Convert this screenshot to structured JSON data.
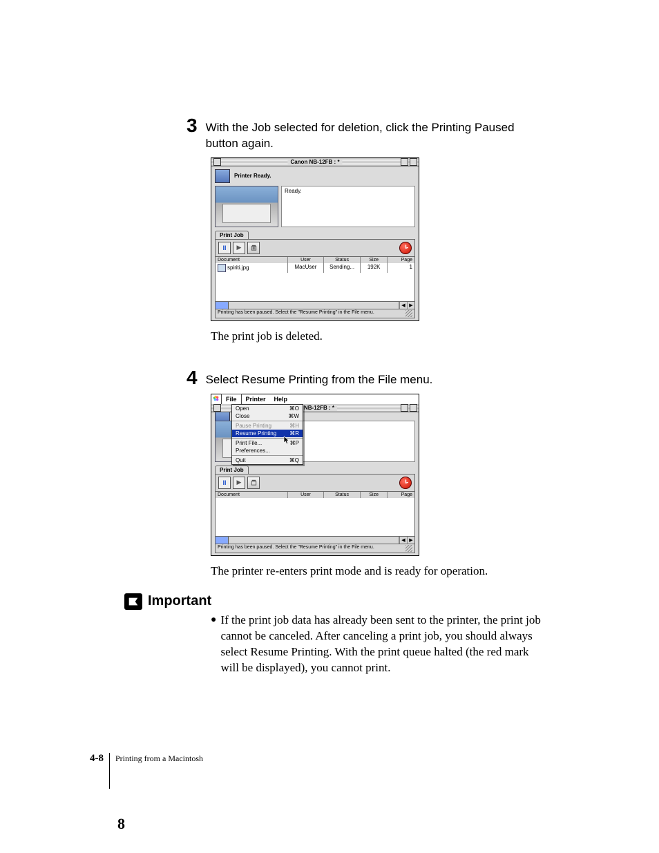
{
  "step3": {
    "num": "3",
    "text": "With the Job selected for deletion, click the Printing Paused button again.",
    "after": "The print job is deleted."
  },
  "step4": {
    "num": "4",
    "text": "Select Resume Printing from the File menu.",
    "after": "The printer re-enters print mode and is ready for operation."
  },
  "win1": {
    "title": "Canon NB-12FB : *",
    "ready_line": "Printer Ready.",
    "ready_box": "Ready.",
    "tab": "Print Job",
    "pause_glyph": "II",
    "play_glyph": "▶",
    "headers": {
      "doc": "Document",
      "user": "User",
      "status": "Status",
      "size": "Size",
      "page": "Page"
    },
    "row": {
      "doc": "spiriti.jpg",
      "user": "MacUser",
      "status": "Sending...",
      "size": "192K",
      "page": "1"
    },
    "statusbar": "Printing has been paused. Select the \"Resume Printing\" in the File menu."
  },
  "win2": {
    "title": "on NB-12FB : *",
    "menubar": {
      "file": "File",
      "printer": "Printer",
      "help": "Help"
    },
    "menu": {
      "open": {
        "label": "Open",
        "sc": "⌘O"
      },
      "close": {
        "label": "Close",
        "sc": "⌘W"
      },
      "pause": {
        "label": "Pause Printing",
        "sc": "⌘H"
      },
      "resume": {
        "label": "Resume Printing",
        "sc": "⌘R"
      },
      "printfile": {
        "label": "Print File...",
        "sc": "⌘P"
      },
      "prefs": {
        "label": "Preferences..."
      },
      "quit": {
        "label": "Quit",
        "sc": "⌘Q"
      }
    },
    "tab": "Print Job",
    "pause_glyph": "II",
    "play_glyph": "▶",
    "headers": {
      "doc": "Document",
      "user": "User",
      "status": "Status",
      "size": "Size",
      "page": "Page"
    },
    "statusbar": "Printing has been paused. Select the \"Resume Printing\" in the File menu."
  },
  "important": {
    "label": "Important",
    "bullet": "If the print job data has already been sent to the printer, the print job cannot be canceled. After canceling a print job, you should always select Resume Printing. With the print queue halted (the red mark will be displayed), you cannot print."
  },
  "footer": {
    "pagelabel": "4-8",
    "section": "Printing from a Macintosh",
    "cornernum": "8"
  }
}
